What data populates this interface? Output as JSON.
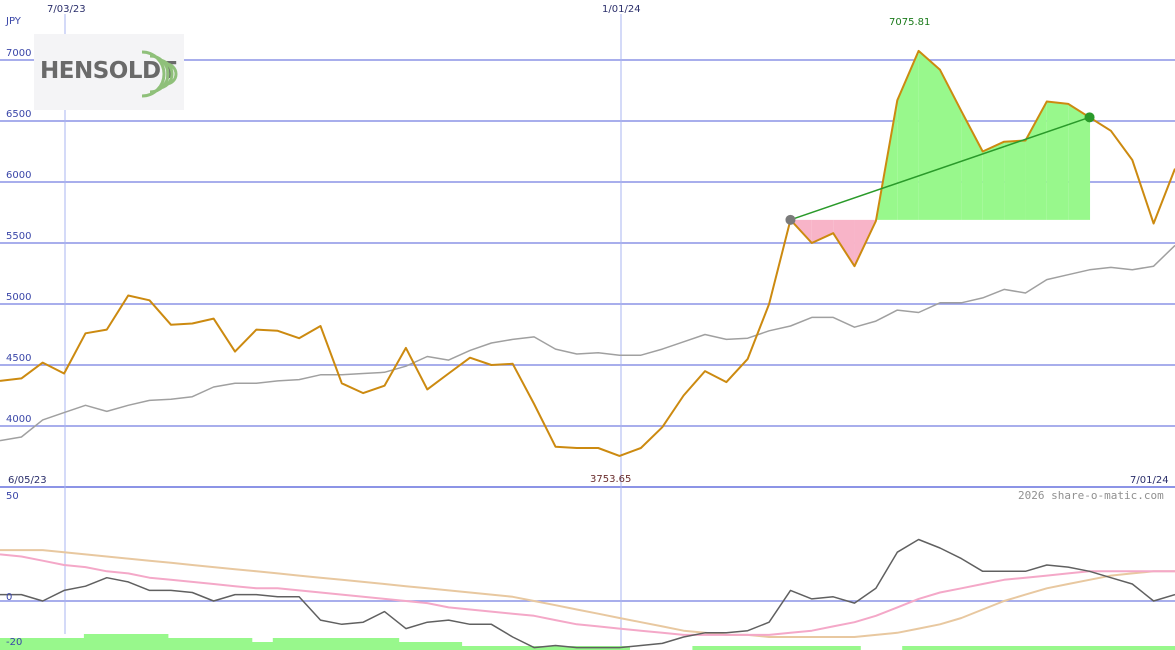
{
  "chart_data": [
    {
      "type": "line",
      "title": "",
      "currency_label": "JPY",
      "ylim": [
        3500,
        7500
      ],
      "yticks": [
        4000,
        4500,
        5000,
        5500,
        6000,
        6500,
        7000
      ],
      "ytick_labels": [
        "4000",
        "4500",
        "5000",
        "5500",
        "6000",
        "6500",
        "7000"
      ],
      "date_labels_top": [
        "7/03/23",
        "1/01/24"
      ],
      "date_labels_bottom": [
        "6/05/23",
        "7/01/24"
      ],
      "max_label": "7075.81",
      "min_label": "3753.65",
      "grid": true,
      "series": [
        {
          "color": "#cc8a10",
          "values": [
            4370,
            4390,
            4520,
            4430,
            4760,
            4790,
            5070,
            5030,
            4830,
            4840,
            4880,
            4610,
            4790,
            4780,
            4720,
            4820,
            4350,
            4270,
            4330,
            4640,
            4300,
            4430,
            4560,
            4500,
            4510,
            4180,
            3830,
            3820,
            3820,
            3755,
            3820,
            3990,
            4250,
            4450,
            4360,
            4550,
            5000,
            5690,
            5500,
            5580,
            5310,
            5680,
            6670,
            7075,
            6920,
            6580,
            6250,
            6330,
            6340,
            6660,
            6640,
            6530,
            6420,
            6180,
            5660,
            6110
          ]
        },
        {
          "color": "#a0a0a0",
          "values": [
            3880,
            3910,
            4050,
            4110,
            4170,
            4120,
            4170,
            4210,
            4220,
            4240,
            4320,
            4350,
            4350,
            4370,
            4380,
            4420,
            4420,
            4430,
            4440,
            4490,
            4570,
            4540,
            4620,
            4680,
            4710,
            4730,
            4630,
            4590,
            4600,
            4580,
            4580,
            4630,
            4690,
            4750,
            4710,
            4720,
            4780,
            4820,
            4890,
            4890,
            4810,
            4860,
            4950,
            4930,
            5010,
            5010,
            5050,
            5120,
            5090,
            5200,
            5240,
            5280,
            5300,
            5280,
            5310,
            5480
          ]
        }
      ],
      "highlight": {
        "start_index": 37,
        "end_index": 51,
        "start_value": 5690,
        "end_value": 6530,
        "trend_color": "#2a9a2a",
        "gain_color": "#98f88c",
        "loss_color": "#f8b4c8"
      }
    },
    {
      "type": "line",
      "title": "",
      "ylim": [
        -20,
        50
      ],
      "ytick_labels": [
        "50",
        "0",
        "-20"
      ],
      "watermark": "2026 share-o-matic.com",
      "series": [
        {
          "color": "#606060",
          "values": [
            3,
            3,
            0,
            5,
            7,
            11,
            9,
            5,
            5,
            4,
            0,
            3,
            3,
            2,
            2,
            -9,
            -11,
            -10,
            -5,
            -13,
            -10,
            -9,
            -11,
            -11,
            -17,
            -22,
            -21,
            -22,
            -22,
            -22,
            -21,
            -20,
            -17,
            -15,
            -15,
            -14,
            -10,
            5,
            1,
            2,
            -1,
            6,
            23,
            29,
            25,
            20,
            14,
            14,
            14,
            17,
            16,
            14,
            11,
            8,
            0,
            3
          ]
        },
        {
          "color": "#f4a8c8",
          "values": [
            22,
            21,
            19,
            17,
            16,
            14,
            13,
            11,
            10,
            9,
            8,
            7,
            6,
            6,
            5,
            4,
            3,
            2,
            1,
            0,
            -1,
            -3,
            -4,
            -5,
            -6,
            -7,
            -9,
            -11,
            -12,
            -13,
            -14,
            -15,
            -16,
            -16,
            -16,
            -16,
            -16,
            -15,
            -14,
            -12,
            -10,
            -7,
            -3,
            1,
            4,
            6,
            8,
            10,
            11,
            12,
            13,
            14,
            14,
            14,
            14,
            14
          ]
        },
        {
          "color": "#e8c8a0",
          "values": [
            24,
            24,
            24,
            23,
            22,
            21,
            20,
            19,
            18,
            17,
            16,
            15,
            14,
            13,
            12,
            11,
            10,
            9,
            8,
            7,
            6,
            5,
            4,
            3,
            2,
            0,
            -2,
            -4,
            -6,
            -8,
            -10,
            -12,
            -14,
            -15,
            -16,
            -16,
            -17,
            -17,
            -17,
            -17,
            -17,
            -16,
            -15,
            -13,
            -11,
            -8,
            -4,
            0,
            3,
            6,
            8,
            10,
            12,
            13,
            14,
            14
          ]
        }
      ],
      "histogram": {
        "color": "#98f88c",
        "values": [
          3,
          3,
          3,
          3,
          4,
          4,
          4,
          4,
          3,
          3,
          3,
          3,
          2,
          3,
          3,
          3,
          3,
          3,
          3,
          2,
          2,
          2,
          1,
          1,
          1,
          1,
          1,
          1,
          1,
          1,
          0,
          0,
          0,
          1,
          1,
          1,
          1,
          1,
          1,
          1,
          1,
          0,
          0,
          1,
          1,
          1,
          1,
          1,
          1,
          1,
          1,
          1,
          1,
          1,
          1,
          1
        ]
      }
    }
  ],
  "logo": {
    "text": "HENSOLDT"
  }
}
